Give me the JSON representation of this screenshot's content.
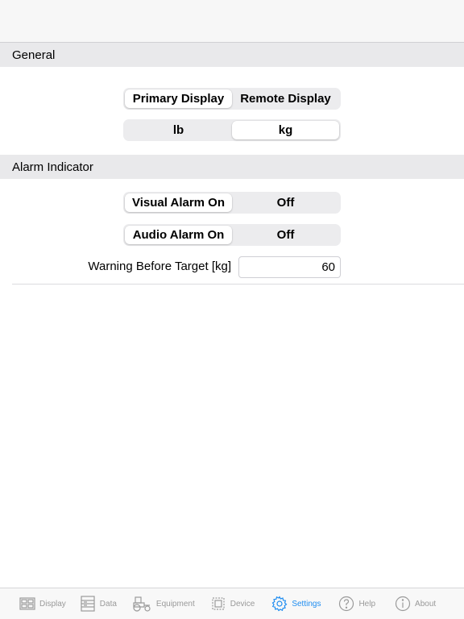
{
  "general": {
    "header": "General",
    "display_segment": {
      "options": [
        "Primary Display",
        "Remote Display"
      ],
      "selected": "Primary Display"
    },
    "unit_segment": {
      "options": [
        "lb",
        "kg"
      ],
      "selected": "kg"
    }
  },
  "alarm": {
    "header": "Alarm Indicator",
    "visual_segment": {
      "options": [
        "Visual Alarm On",
        "Off"
      ],
      "selected": "Visual Alarm On"
    },
    "audio_segment": {
      "options": [
        "Audio Alarm On",
        "Off"
      ],
      "selected": "Audio Alarm On"
    },
    "warning_label": "Warning Before Target [kg]",
    "warning_value": "60"
  },
  "tabbar": {
    "accent_color": "#1e8cf0",
    "inactive_color": "#999999",
    "items": [
      {
        "label": "Display",
        "icon": "display-icon",
        "active": false
      },
      {
        "label": "Data",
        "icon": "data-icon",
        "active": false
      },
      {
        "label": "Equipment",
        "icon": "tractor-icon",
        "active": false
      },
      {
        "label": "Device",
        "icon": "device-icon",
        "active": false
      },
      {
        "label": "Settings",
        "icon": "gear-icon",
        "active": true
      },
      {
        "label": "Help",
        "icon": "help-icon",
        "active": false
      },
      {
        "label": "About",
        "icon": "info-icon",
        "active": false
      }
    ]
  }
}
